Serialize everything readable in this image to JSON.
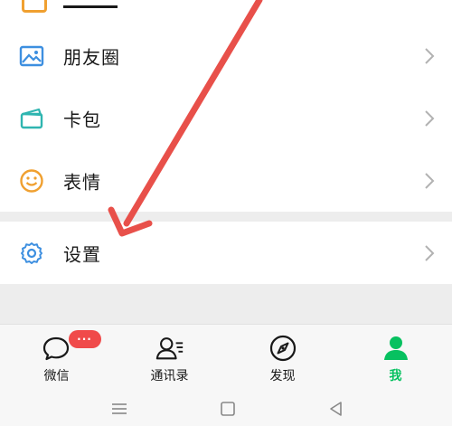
{
  "menu": {
    "items": [
      {
        "label": "朋友圈",
        "icon": "image-icon"
      },
      {
        "label": "卡包",
        "icon": "card-icon"
      },
      {
        "label": "表情",
        "icon": "smile-icon"
      },
      {
        "label": "设置",
        "icon": "gear-icon"
      }
    ]
  },
  "tabbar": {
    "tabs": [
      {
        "label": "微信",
        "icon": "chat-icon",
        "badge": "···"
      },
      {
        "label": "通讯录",
        "icon": "contacts-icon"
      },
      {
        "label": "发现",
        "icon": "compass-icon"
      },
      {
        "label": "我",
        "icon": "person-icon",
        "active": true
      }
    ]
  },
  "colors": {
    "accent": "#07c160",
    "badge": "#f04a4a",
    "annotation_arrow": "#e8504a",
    "icon_blue": "#3d8fe0",
    "icon_teal": "#2fb5b0",
    "icon_orange": "#f0a030"
  }
}
